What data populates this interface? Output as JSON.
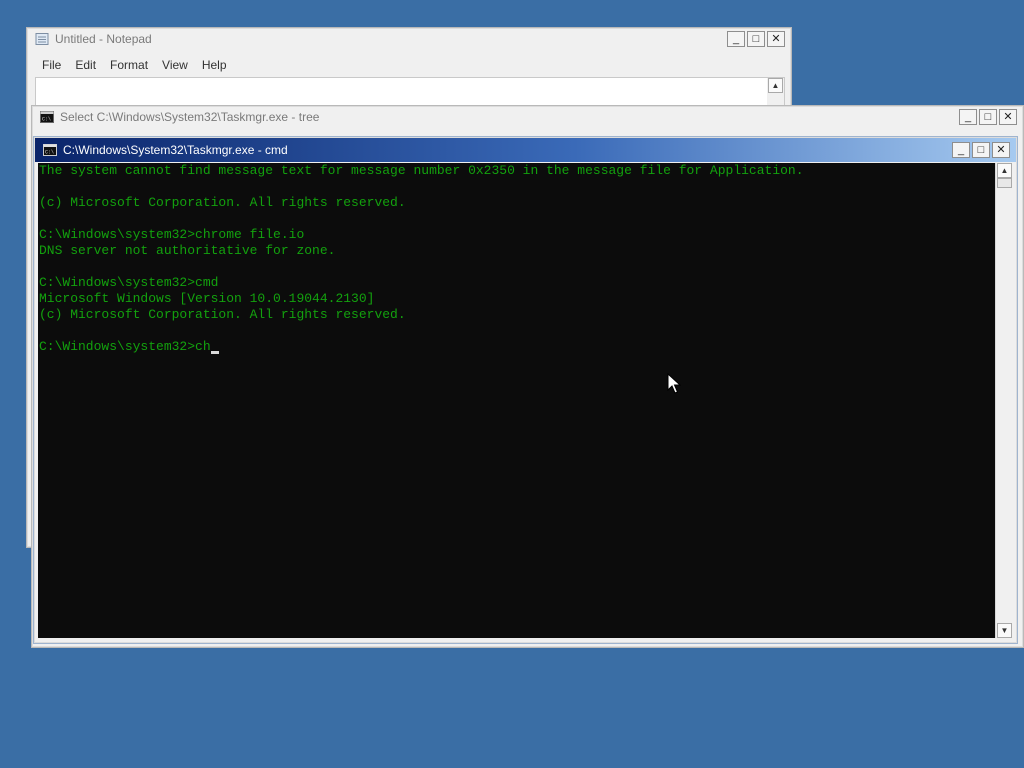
{
  "notepad": {
    "title": "Untitled - Notepad",
    "menu": [
      "File",
      "Edit",
      "Format",
      "View",
      "Help"
    ],
    "buttons": {
      "minimize": "_",
      "maximize": "□",
      "close": "✕"
    }
  },
  "tree_window": {
    "title": "Select C:\\Windows\\System32\\Taskmgr.exe - tree",
    "buttons": {
      "minimize": "_",
      "maximize": "□",
      "close": "✕"
    }
  },
  "cmd_window": {
    "title": "C:\\Windows\\System32\\Taskmgr.exe - cmd",
    "buttons": {
      "minimize": "_",
      "maximize": "□",
      "close": "✕"
    },
    "lines": [
      "The system cannot find message text for message number 0x2350 in the message file for Application.",
      "",
      "(c) Microsoft Corporation. All rights reserved.",
      "",
      "C:\\Windows\\system32>chrome file.io",
      "DNS server not authoritative for zone.",
      "",
      "C:\\Windows\\system32>cmd",
      "Microsoft Windows [Version 10.0.19044.2130]",
      "(c) Microsoft Corporation. All rights reserved.",
      "",
      "C:\\Windows\\system32>ch"
    ],
    "scroll_up": "▲",
    "scroll_down": "▼"
  },
  "colors": {
    "desktop": "#3a6ea5",
    "console_bg": "#0c0c0c",
    "console_text": "#13a10e",
    "active_title": "#0a246a"
  }
}
